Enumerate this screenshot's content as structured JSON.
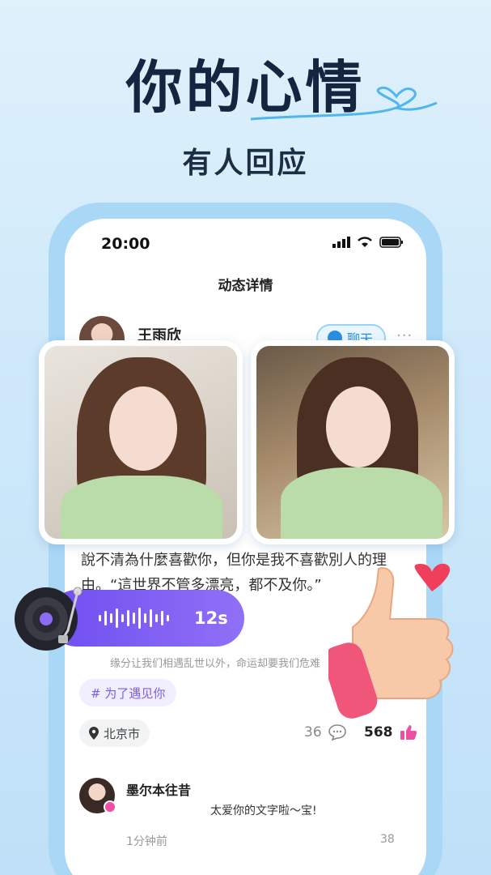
{
  "hero": {
    "title": "你的心情",
    "subtitle": "有人回应"
  },
  "status_bar": {
    "time": "20:00"
  },
  "nav": {
    "title": "动态详情"
  },
  "post": {
    "author": "王雨欣",
    "chat_label": "聊天",
    "more_label": "···",
    "text": "說不清為什麼喜歡你，但你是我不喜歡別人的理由。“這世界不管多漂亮，都不及你。”",
    "voice_duration": "12s",
    "sub_text": "缘分让我们相遇乱世以外，命运却要我们危难",
    "tag": "# 为了遇见你",
    "location": "北京市",
    "comment_count": "36",
    "like_count": "568"
  },
  "comment": {
    "name": "墨尔本往昔",
    "text": "太爱你的文字啦～宝!",
    "time": "1分钟前",
    "likes": "38"
  },
  "colors": {
    "accent": "#7a5ce8",
    "like": "#ef4fa0",
    "chat": "#2b8fe0"
  }
}
